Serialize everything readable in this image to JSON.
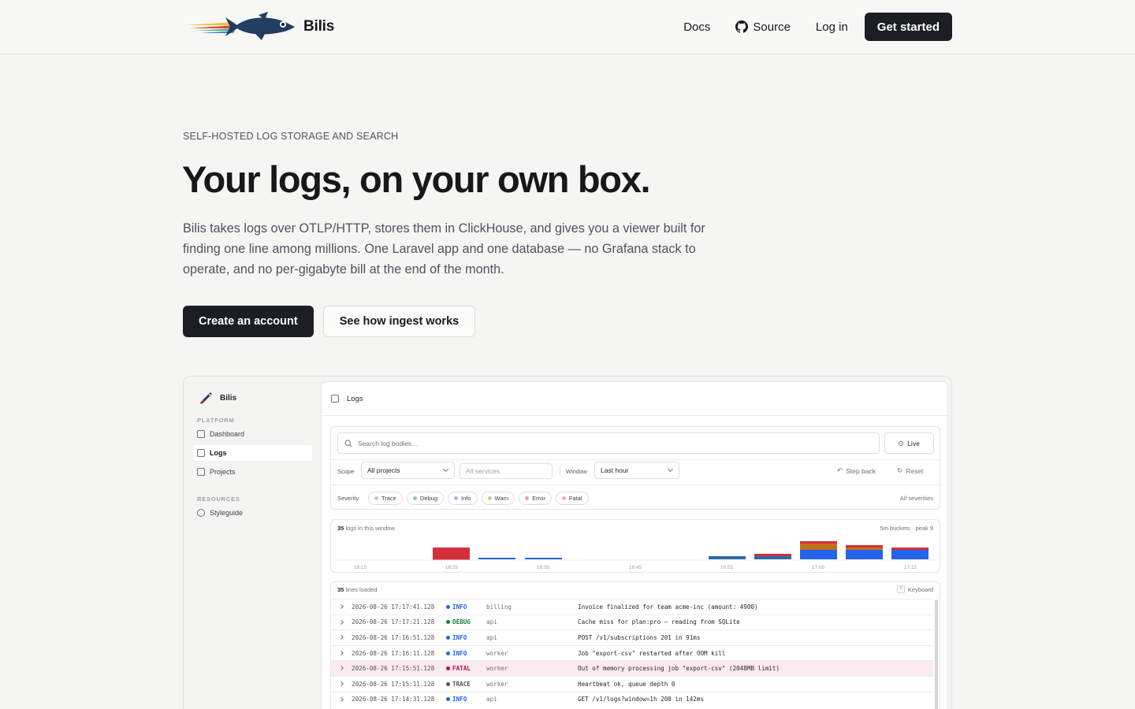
{
  "nav": {
    "brand": "Bilis",
    "links": {
      "docs": "Docs",
      "source": "Source",
      "login": "Log in"
    },
    "cta": "Get started"
  },
  "hero": {
    "eyebrow": "SELF-HOSTED LOG STORAGE AND SEARCH",
    "headline": "Your logs, on your own box.",
    "lede": "Bilis takes logs over OTLP/HTTP, stores them in ClickHouse, and gives you a viewer built for finding one line among millions. One Laravel app and one database — no Grafana stack to operate, and no per-gigabyte bill at the end of the month.",
    "primary_cta": "Create an account",
    "secondary_cta": "See how ingest works"
  },
  "app": {
    "brand": "Bilis",
    "sidebar": {
      "platform_label": "PLATFORM",
      "items": [
        {
          "label": "Dashboard",
          "icon": "grid-icon"
        },
        {
          "label": "Logs",
          "icon": "list-icon",
          "active": true
        },
        {
          "label": "Projects",
          "icon": "folder-icon"
        }
      ],
      "resources_label": "RESOURCES",
      "resources": [
        {
          "label": "Styleguide",
          "icon": "palette-icon"
        }
      ]
    },
    "page_title": "Logs",
    "search": {
      "placeholder": "Search log bodies…",
      "live_label": "Live"
    },
    "filters": {
      "scope_label": "Scope",
      "scope_value": "All projects",
      "services_placeholder": "All services",
      "window_label": "Window",
      "window_value": "Last hour",
      "step_back": "Step back",
      "reset": "Reset",
      "severity_label": "Severity",
      "severities": [
        {
          "label": "Trace",
          "color": "#a1a1aa"
        },
        {
          "label": "Debug",
          "color": "#5eae8c"
        },
        {
          "label": "Info",
          "color": "#7aa2d6"
        },
        {
          "label": "Warn",
          "color": "#c9a45a"
        },
        {
          "label": "Error",
          "color": "#e07a7a"
        },
        {
          "label": "Fatal",
          "color": "#e48aa0"
        }
      ],
      "all_severities": "All severities"
    },
    "histogram": {
      "count": "35",
      "count_suffix": "logs in this window",
      "meta": "5m buckets · peak 9",
      "ticks": [
        "16:15",
        "16:25",
        "16:35",
        "16:45",
        "16:55",
        "17:05",
        "17:15"
      ]
    },
    "logs": {
      "count": "35",
      "count_suffix": "lines loaded",
      "keyboard_key": "?",
      "keyboard_label": "Keyboard",
      "rows": [
        {
          "ts": "2026-08-26 17:17:41.128",
          "sev": "INFO",
          "svc": "billing",
          "msg": "Invoice finalized for team acme-inc (amount: 4900)"
        },
        {
          "ts": "2026-08-26 17:17:21.128",
          "sev": "DEBUG",
          "svc": "api",
          "msg": "Cache miss for plan:pro — reading from SQLite"
        },
        {
          "ts": "2026-08-26 17:16:51.128",
          "sev": "INFO",
          "svc": "api",
          "msg": "POST /v1/subscriptions 201 in 91ms"
        },
        {
          "ts": "2026-08-26 17:16:11.128",
          "sev": "INFO",
          "svc": "worker",
          "msg": "Job \"export-csv\" restarted after OOM kill"
        },
        {
          "ts": "2026-08-26 17:15:51.128",
          "sev": "FATAL",
          "svc": "worker",
          "msg": "Out of memory processing job \"export-csv\" (2048MB limit)"
        },
        {
          "ts": "2026-08-26 17:15:11.128",
          "sev": "TRACE",
          "svc": "worker",
          "msg": "Heartbeat ok, queue depth 0"
        },
        {
          "ts": "2026-08-26 17:14:31.128",
          "sev": "INFO",
          "svc": "api",
          "msg": "GET /v1/logs?window=1h 200 in 142ms"
        }
      ]
    }
  },
  "colors": {
    "info": "#2563eb",
    "debug": "#15803d",
    "fatal": "#be123c",
    "trace": "#52525b",
    "error_bar": "#d32f3a",
    "warn_bar": "#c2701c"
  }
}
